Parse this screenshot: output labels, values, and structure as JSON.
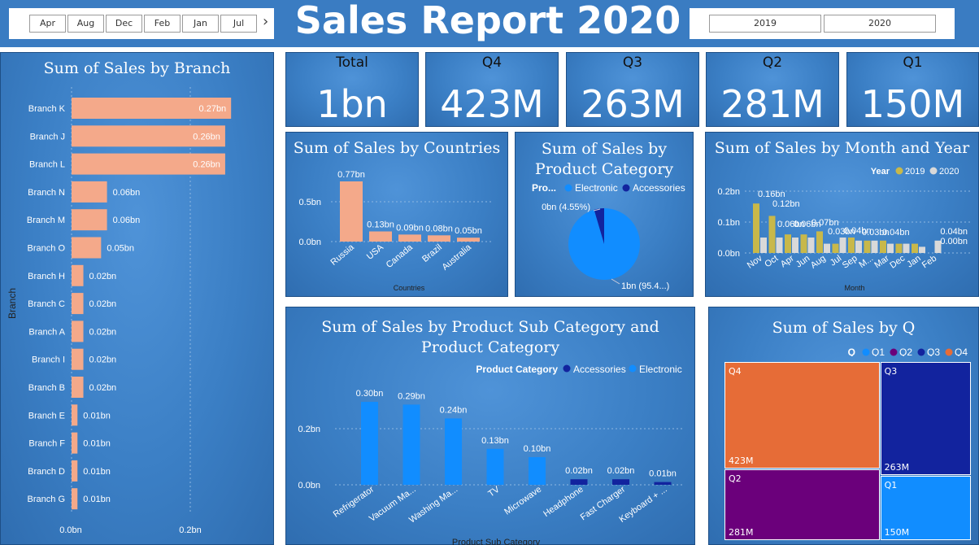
{
  "header": {
    "title": "Sales Report 2020",
    "months": [
      "Apr",
      "Aug",
      "Dec",
      "Feb",
      "Jan",
      "Jul"
    ],
    "more_arrow": "›",
    "years": [
      "2019",
      "2020"
    ]
  },
  "kpis": [
    {
      "label": "Total",
      "value": "1bn"
    },
    {
      "label": "Q4",
      "value": "423M"
    },
    {
      "label": "Q3",
      "value": "263M"
    },
    {
      "label": "Q2",
      "value": "281M"
    },
    {
      "label": "Q1",
      "value": "150M"
    }
  ],
  "colors": {
    "salmon": "#f4a98a",
    "electronic": "#118dff",
    "accessories": "#12239e",
    "y2019": "#c8b84a",
    "y2020": "#d9d9d9",
    "q1": "#118dff",
    "q2": "#6b007b",
    "q3": "#12239e",
    "q4": "#e66c37"
  },
  "chart_data": [
    {
      "id": "branch",
      "type": "bar",
      "orientation": "horizontal",
      "title": "Sum of Sales by Branch",
      "ylabel": "Branch",
      "categories": [
        "Branch K",
        "Branch J",
        "Branch L",
        "Branch N",
        "Branch M",
        "Branch O",
        "Branch H",
        "Branch C",
        "Branch A",
        "Branch I",
        "Branch B",
        "Branch E",
        "Branch F",
        "Branch D",
        "Branch G"
      ],
      "values": [
        0.27,
        0.26,
        0.26,
        0.06,
        0.06,
        0.05,
        0.02,
        0.02,
        0.02,
        0.02,
        0.02,
        0.01,
        0.01,
        0.01,
        0.01
      ],
      "labels": [
        "0.27bn",
        "0.26bn",
        "0.26bn",
        "0.06bn",
        "0.06bn",
        "0.05bn",
        "0.02bn",
        "0.02bn",
        "0.02bn",
        "0.02bn",
        "0.02bn",
        "0.01bn",
        "0.01bn",
        "0.01bn",
        "0.01bn"
      ],
      "xticks": [
        "0.0bn",
        "0.2bn"
      ],
      "xlim": [
        0,
        0.3
      ]
    },
    {
      "id": "countries",
      "type": "bar",
      "title": "Sum of Sales by Countries",
      "xlabel": "Countries",
      "categories": [
        "Russia",
        "USA",
        "Canada",
        "Brazil",
        "Australia"
      ],
      "values": [
        0.77,
        0.13,
        0.09,
        0.08,
        0.05
      ],
      "labels": [
        "0.77bn",
        "0.13bn",
        "0.09bn",
        "0.08bn",
        "0.05bn"
      ],
      "yticks": [
        "0.0bn",
        "0.5bn"
      ],
      "ylim": [
        0,
        0.77
      ]
    },
    {
      "id": "category",
      "type": "pie",
      "title": "Sum of Sales by Product Category",
      "legend_title": "Pro...",
      "legend": [
        "Electronic",
        "Accessories"
      ],
      "values": [
        95.45,
        4.55
      ],
      "labels": [
        "1bn (95.4...)",
        "0bn (4.55%)"
      ]
    },
    {
      "id": "month_year",
      "type": "bar",
      "title": "Sum of Sales by Month and Year",
      "xlabel": "Month",
      "legend_title": "Year",
      "categories": [
        "Nov",
        "Oct",
        "Apr",
        "Jun",
        "Aug",
        "Jul",
        "Sep",
        "M...",
        "Mar",
        "Dec",
        "Jan",
        "Feb"
      ],
      "series": [
        {
          "name": "2019",
          "values": [
            0.16,
            0.12,
            0.06,
            0.06,
            0.07,
            0.03,
            0.05,
            0.04,
            0.04,
            0.03,
            0.03,
            0.0
          ]
        },
        {
          "name": "2020",
          "values": [
            0.05,
            0.05,
            0.05,
            0.05,
            0.03,
            0.05,
            0.04,
            0.04,
            0.03,
            0.03,
            0.02,
            0.04
          ]
        }
      ],
      "visible_labels": [
        "0.16bn",
        "0.12bn",
        "0.06bn",
        "0.06bn",
        "0.07bn",
        "0.03bn",
        "0.04bn",
        "0.03bn",
        "0.04bn",
        "0.00bn"
      ],
      "yticks": [
        "0.0bn",
        "0.1bn",
        "0.2bn"
      ],
      "ylim": [
        0,
        0.2
      ]
    },
    {
      "id": "subcategory",
      "type": "bar",
      "title": "Sum of Sales by Product Sub Category and Product Category",
      "xlabel": "Product Sub Category",
      "legend_title": "Product Category",
      "legend": [
        "Accessories",
        "Electronic"
      ],
      "categories": [
        "Refrigerator",
        "Vacuum Ma...",
        "Washing Ma...",
        "TV",
        "Microwave",
        "Headphone",
        "Fast Charger",
        "Keyboard + ..."
      ],
      "values": [
        0.3,
        0.29,
        0.24,
        0.13,
        0.1,
        0.02,
        0.02,
        0.01
      ],
      "category_of": [
        "Electronic",
        "Electronic",
        "Electronic",
        "Electronic",
        "Electronic",
        "Accessories",
        "Accessories",
        "Accessories"
      ],
      "labels": [
        "0.30bn",
        "0.29bn",
        "0.24bn",
        "0.13bn",
        "0.10bn",
        "0.02bn",
        "0.02bn",
        "0.01bn"
      ],
      "yticks": [
        "0.0bn",
        "0.2bn"
      ],
      "ylim": [
        0,
        0.3
      ]
    },
    {
      "id": "quarter",
      "type": "treemap",
      "title": "Sum of Sales by Q",
      "legend_title": "Q",
      "legend": [
        "Q1",
        "Q2",
        "Q3",
        "Q4"
      ],
      "items": [
        {
          "name": "Q4",
          "value": 423,
          "label": "423M"
        },
        {
          "name": "Q2",
          "value": 281,
          "label": "281M"
        },
        {
          "name": "Q3",
          "value": 263,
          "label": "263M"
        },
        {
          "name": "Q1",
          "value": 150,
          "label": "150M"
        }
      ]
    }
  ]
}
